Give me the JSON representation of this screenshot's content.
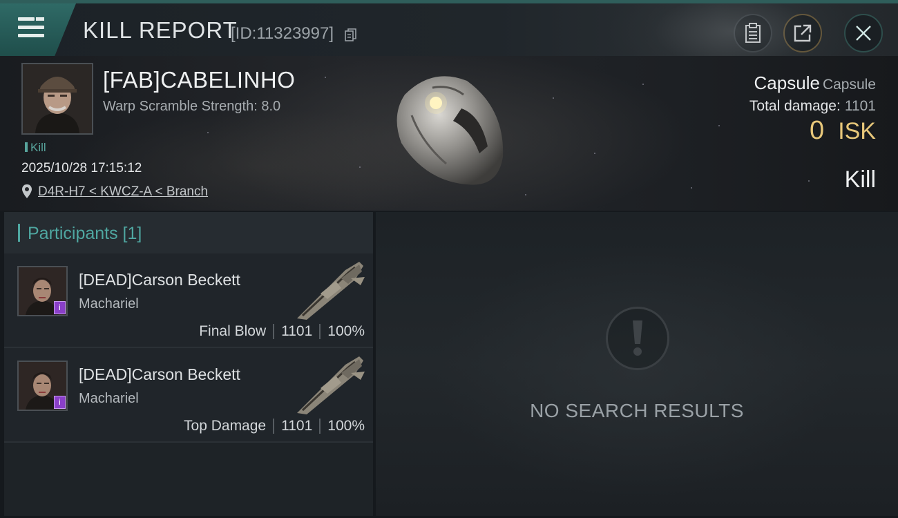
{
  "header": {
    "title": "KILL REPORT",
    "report_id": "[ID:11323997]"
  },
  "icons": {
    "menu": "hamburger-icon",
    "copy": "copy-icon",
    "clipboard": "clipboard-icon",
    "share": "share-icon",
    "close": "close-icon",
    "location": "location-pin-icon",
    "warning": "exclamation-icon",
    "badge": "info-badge-icon"
  },
  "victim": {
    "name": "[FAB]CABELINHO",
    "subline": "Warp Scramble Strength: 8.0",
    "tag": "Kill",
    "datetime": "2025/10/28 17:15:12",
    "location": "D4R-H7 < KWCZ-A < Branch",
    "ship_name": "Capsule",
    "ship_class": "Capsule",
    "damage_label": "Total damage:",
    "damage_value": "1101",
    "isk_value": "0",
    "isk_unit": "ISK",
    "result": "Kill"
  },
  "participants": {
    "label": "Participants [1]",
    "rows": [
      {
        "name": "[DEAD]Carson Beckett",
        "ship": "Machariel",
        "role": "Final Blow",
        "damage": "1101",
        "percent": "100%",
        "badge": "i"
      },
      {
        "name": "[DEAD]Carson Beckett",
        "ship": "Machariel",
        "role": "Top Damage",
        "damage": "1101",
        "percent": "100%",
        "badge": "i"
      }
    ]
  },
  "empty_panel": {
    "message": "NO SEARCH RESULTS"
  },
  "colors": {
    "accent_teal": "#4fa7a1",
    "isk_gold": "#e7c77a",
    "badge_purple": "#8a3fc8"
  }
}
